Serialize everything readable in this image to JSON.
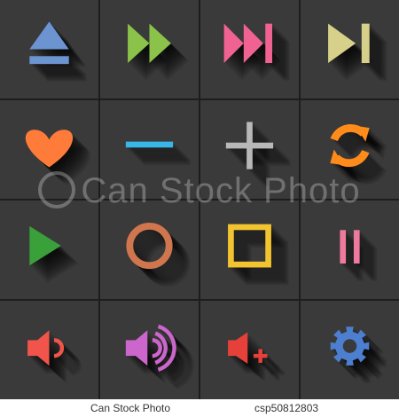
{
  "icons": [
    {
      "name": "eject-icon",
      "color": "#6b94d1"
    },
    {
      "name": "fast-forward-icon",
      "color": "#8bc34a"
    },
    {
      "name": "skip-forward-icon",
      "color": "#f06292"
    },
    {
      "name": "next-track-icon",
      "color": "#d6d08a"
    },
    {
      "name": "heart-icon",
      "color": "#ff7b3a"
    },
    {
      "name": "minus-icon",
      "color": "#37b8e8"
    },
    {
      "name": "plus-icon",
      "color": "#b8b8b8"
    },
    {
      "name": "refresh-icon",
      "color": "#ff8c1a"
    },
    {
      "name": "play-icon",
      "color": "#3aa03a"
    },
    {
      "name": "record-icon",
      "color": "#d0764e"
    },
    {
      "name": "stop-icon",
      "color": "#f2c530"
    },
    {
      "name": "pause-icon",
      "color": "#ee7a9e"
    },
    {
      "name": "volume-low-icon",
      "color": "#f0544a"
    },
    {
      "name": "volume-high-icon",
      "color": "#cc66cc"
    },
    {
      "name": "volume-up-icon",
      "color": "#e5413a"
    },
    {
      "name": "settings-gear-icon",
      "color": "#4d7fd1"
    }
  ],
  "tile_background": "#3a3a3a",
  "grid_line_color": "#1d1d1d",
  "watermark": {
    "text": "Can Stock Photo"
  },
  "footer": {
    "left": "Can Stock Photo",
    "right": "csp50812803"
  }
}
